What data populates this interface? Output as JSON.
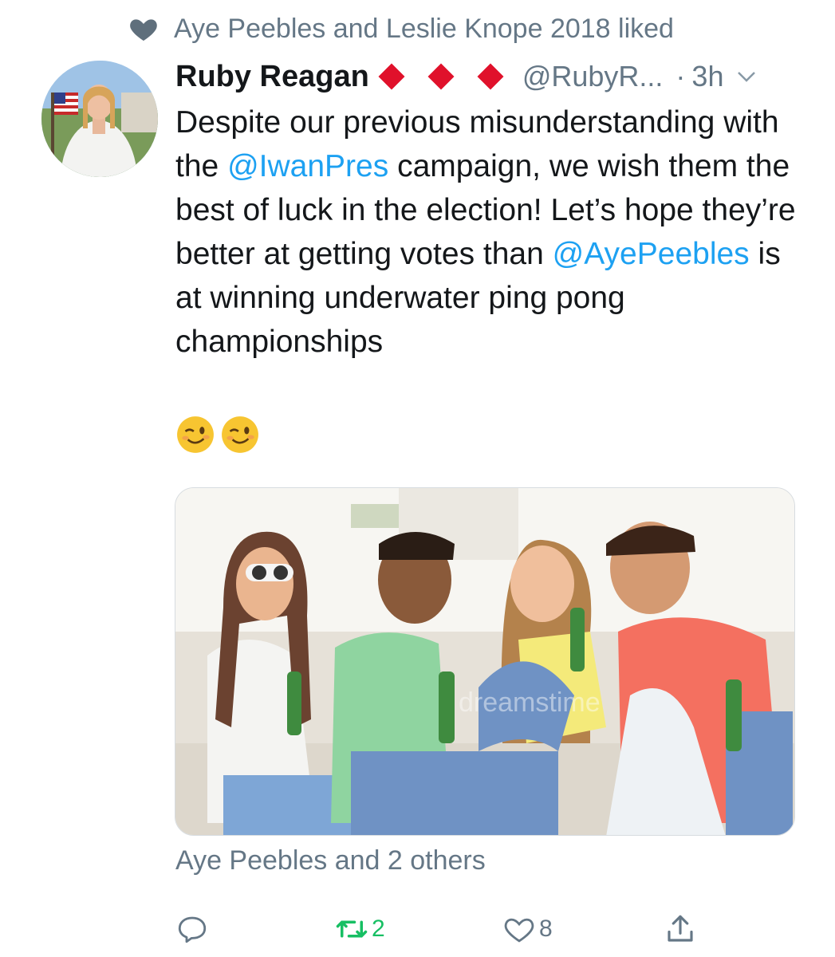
{
  "social_context": {
    "text": "Aye Peebles and Leslie Knope 2018 liked",
    "icon": "heart-icon"
  },
  "tweet": {
    "display_name": "Ruby Reagan",
    "badges": [
      "red-diamond-emoji",
      "red-diamond-emoji",
      "red-diamond-emoji"
    ],
    "handle": "@RubyR...",
    "separator": "·",
    "timestamp": "3h",
    "text_parts": [
      "Despite our previous misunderstanding with the ",
      "@IwanPres",
      " campaign, we wish them the best of luck in the election! Let’s hope they’re better at getting votes than ",
      "@AyePeebles",
      " is at winning underwater ping pong championships"
    ],
    "emojis": [
      "winking-face-emoji",
      "winking-face-emoji"
    ],
    "watermark": "dreamstime"
  },
  "likers": "Aye Peebles and 2 others",
  "actions": {
    "reply_count": "",
    "retweet_count": "2",
    "like_count": "8",
    "share_count": ""
  },
  "colors": {
    "link": "#1da1f2",
    "secondary_text": "#657786",
    "retweet_green": "#17bf63",
    "diamond_red": "#e0112b"
  }
}
